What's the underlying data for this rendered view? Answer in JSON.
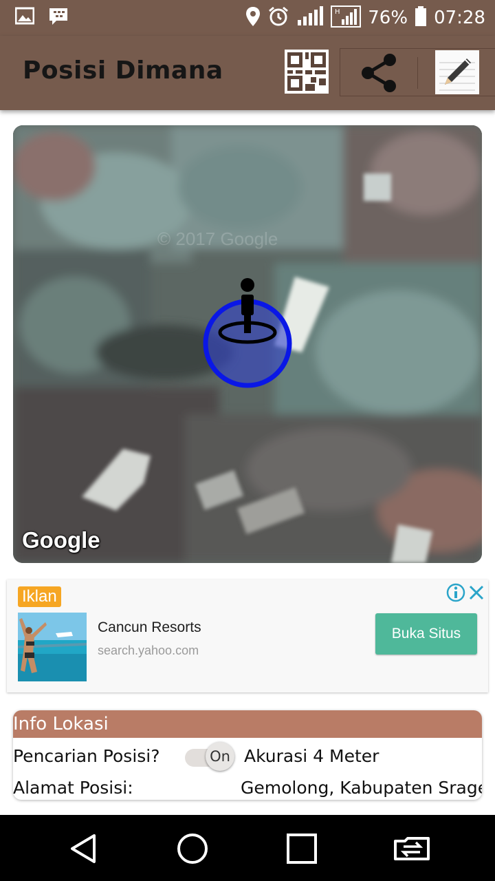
{
  "status_bar": {
    "battery_percent": "76%",
    "time": "07:28",
    "icons": [
      "gallery-icon",
      "bbm-icon",
      "location-icon",
      "alarm-icon",
      "signal-icon",
      "hsdpa-signal-icon",
      "battery-icon"
    ]
  },
  "app_bar": {
    "title": "Posisi Dimana",
    "actions": [
      "qr-code-icon",
      "share-icon",
      "edit-icon"
    ]
  },
  "map": {
    "attribution": "Google",
    "watermark": "© 2017 Google"
  },
  "ad": {
    "badge": "Iklan",
    "title": "Cancun Resorts",
    "url": "search.yahoo.com",
    "cta": "Buka Situs"
  },
  "info": {
    "header": "Info Lokasi",
    "search_label": "Pencarian Posisi?",
    "toggle_label": "On",
    "accuracy": "Akurasi 4 Meter",
    "address_label": "Alamat Posisi:",
    "address_value": "Gemolong, Kabupaten Srage"
  },
  "colors": {
    "primary": "#765b4d",
    "info_header": "#b97c66",
    "ad_button": "#4fb89a",
    "ad_badge": "#f6a623",
    "marker_ring": "#0a17e6"
  }
}
